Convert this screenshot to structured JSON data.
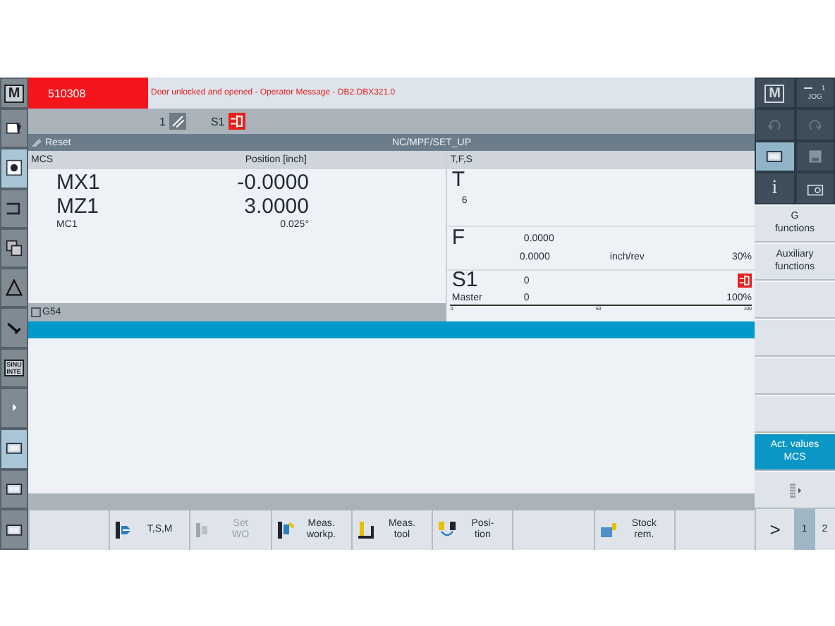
{
  "alarm": {
    "number": "510308",
    "message": "Door unlocked and opened - Operator Message -  DB2.DBX321.0"
  },
  "status": {
    "channel": "1",
    "spindle": "S1"
  },
  "path_bar": {
    "reset": "Reset",
    "program": "NC/MPF/SET_UP"
  },
  "axes_panel": {
    "columns": [
      "MCS",
      "Position [inch]"
    ],
    "axes": [
      {
        "name": "MX1",
        "value": "-0.0000",
        "kind": "large"
      },
      {
        "name": "MZ1",
        "value": "3.0000",
        "kind": "large"
      },
      {
        "name": "MC1",
        "value": "0.025°",
        "kind": "small"
      }
    ],
    "work_offset": "G54"
  },
  "tfs_panel": {
    "title": "T,F,S",
    "tool": {
      "label": "T",
      "number": "6"
    },
    "feed": {
      "label": "F",
      "value": "0.0000",
      "actual": "0.0000",
      "unit": "inch/rev",
      "override": "30%"
    },
    "spindle": {
      "label": "S1",
      "value": "0",
      "mode": "Master",
      "actual": "0",
      "override": "100%",
      "scale": [
        "0",
        "50",
        "100"
      ]
    }
  },
  "left_keys": [
    {
      "kind": "letter",
      "text": "M",
      "selected": false
    },
    {
      "kind": "sheet",
      "selected": false
    },
    {
      "kind": "target",
      "selected": true
    },
    {
      "kind": "bracket",
      "selected": false
    },
    {
      "kind": "pages",
      "selected": false
    },
    {
      "kind": "triangle",
      "selected": false
    },
    {
      "kind": "wrench",
      "selected": false
    },
    {
      "kind": "letters",
      "text": "SINU\nINTE",
      "selected": false
    }
  ],
  "left_lower_keys": [
    {
      "kind": "arrow",
      "selected": false
    },
    {
      "kind": "screen",
      "selected": true
    },
    {
      "kind": "screen",
      "selected": false
    },
    {
      "kind": "screen",
      "selected": false
    }
  ],
  "right_keys": [
    {
      "kind": "letter",
      "text": "M",
      "selected": false
    },
    {
      "kind": "jog",
      "text": "1",
      "label": "JOG",
      "selected": false
    },
    {
      "kind": "undo",
      "selected": false
    },
    {
      "kind": "redo",
      "selected": false
    },
    {
      "kind": "screen",
      "selected": true
    },
    {
      "kind": "disk",
      "selected": false
    },
    {
      "kind": "letter",
      "text": "i",
      "selected": false
    },
    {
      "kind": "camera",
      "selected": false
    }
  ],
  "vertical_softkeys": [
    {
      "kind": "text",
      "label": "G\nfunctions",
      "selected": false
    },
    {
      "kind": "text",
      "label": "Auxiliary\nfunctions",
      "selected": false
    },
    {
      "kind": "blank",
      "selected": false
    },
    {
      "kind": "blank",
      "selected": false
    },
    {
      "kind": "blank",
      "selected": false
    },
    {
      "kind": "blank",
      "selected": false
    },
    {
      "kind": "text",
      "label": "Act. values\nMCS",
      "selected": true
    },
    {
      "kind": "list",
      "selected": false
    }
  ],
  "horizontal_softkeys": [
    {
      "kind": "blank"
    },
    {
      "kind": "tsm",
      "label": "T,S,M",
      "disabled": false
    },
    {
      "kind": "set_wo",
      "label": "Set\nWO",
      "disabled": true
    },
    {
      "kind": "meas_workpiece",
      "label": "Meas.\nworkp.",
      "disabled": false
    },
    {
      "kind": "meas_tool",
      "label": "Meas.\ntool",
      "disabled": false
    },
    {
      "kind": "position",
      "label": "Posi-\ntion",
      "disabled": false
    },
    {
      "kind": "blank"
    },
    {
      "kind": "stock",
      "label": "Stock\nrem.",
      "disabled": false
    },
    {
      "kind": "blank"
    }
  ],
  "page_nav": {
    "next": ">",
    "pages": [
      {
        "label": "1",
        "selected": true
      },
      {
        "label": "2",
        "selected": false
      }
    ]
  }
}
